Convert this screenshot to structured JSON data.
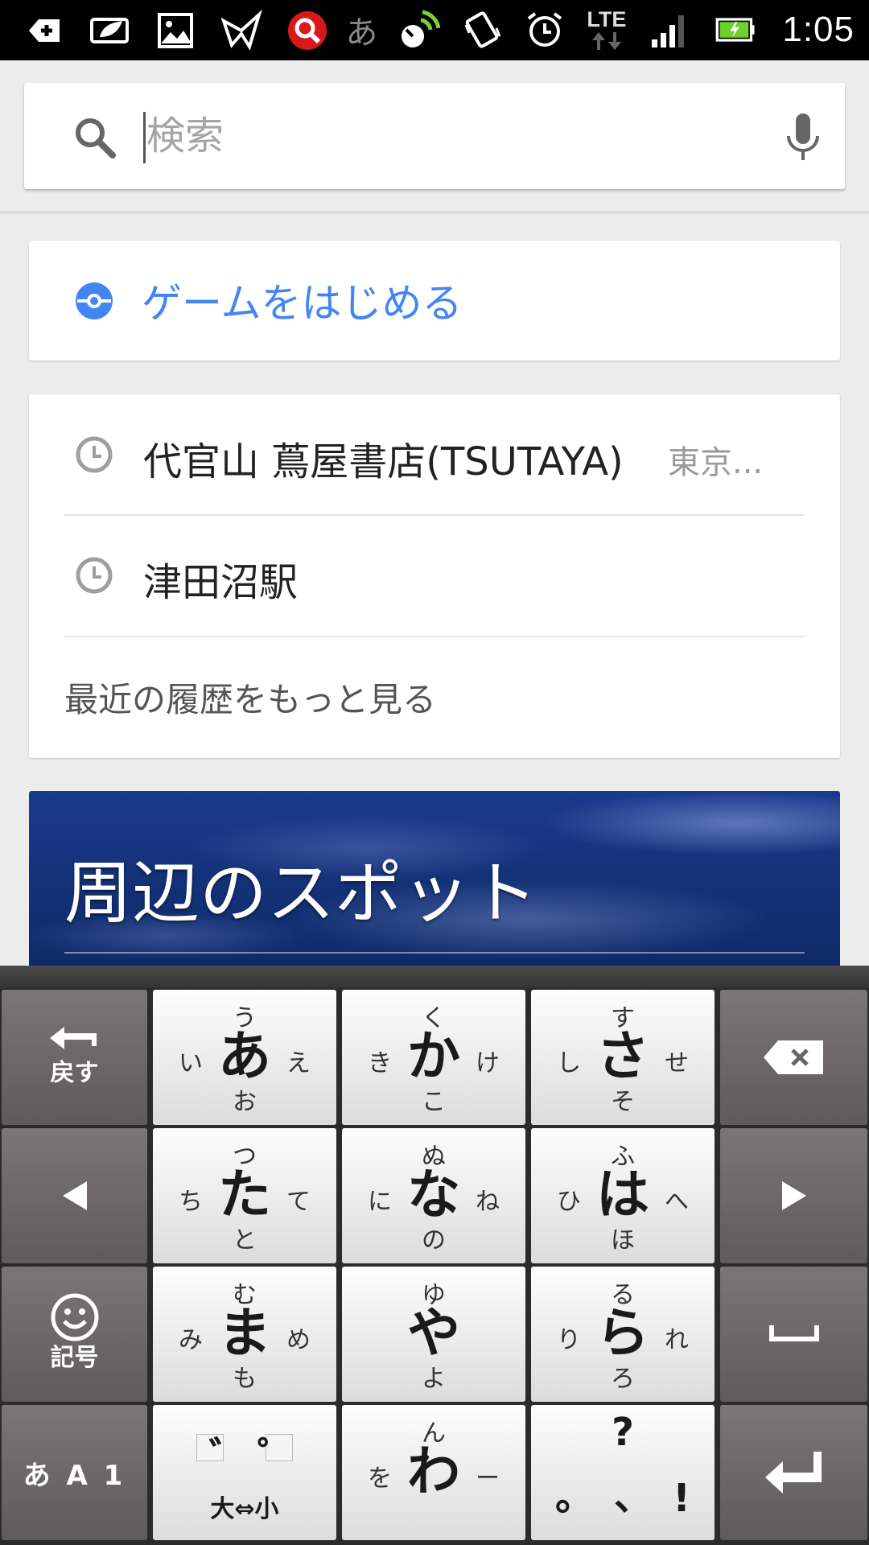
{
  "status_bar": {
    "left_icons": [
      "add-icon",
      "eco-icon",
      "gallery-icon",
      "origami-icon",
      "search-app-icon"
    ],
    "ime_indicator": "あ",
    "network": "LTE",
    "time": "1:05",
    "battery_color": "#6bd12b"
  },
  "search": {
    "placeholder": "検索",
    "value": ""
  },
  "game_card": {
    "label": "ゲームをはじめる",
    "accent": "#4285f4"
  },
  "history": {
    "items": [
      {
        "title": "代官山 蔦屋書店(TSUTAYA)",
        "subtitle": "東京..."
      },
      {
        "title": "津田沼駅",
        "subtitle": ""
      }
    ],
    "more_label": "最近の履歴をもっと見る"
  },
  "spots_card": {
    "title": "周辺のスポット"
  },
  "keyboard": {
    "left_column": {
      "undo_label": "戻す",
      "symbol_label": "記号",
      "mode_label": "あ A 1"
    },
    "keys": [
      {
        "main": "あ",
        "up": "う",
        "left": "い",
        "right": "え",
        "down": "お"
      },
      {
        "main": "か",
        "up": "く",
        "left": "き",
        "right": "け",
        "down": "こ"
      },
      {
        "main": "さ",
        "up": "す",
        "left": "し",
        "right": "せ",
        "down": "そ"
      },
      {
        "main": "た",
        "up": "つ",
        "left": "ち",
        "right": "て",
        "down": "と"
      },
      {
        "main": "な",
        "up": "ぬ",
        "left": "に",
        "right": "ね",
        "down": "の"
      },
      {
        "main": "は",
        "up": "ふ",
        "left": "ひ",
        "right": "へ",
        "down": "ほ"
      },
      {
        "main": "ま",
        "up": "む",
        "left": "み",
        "right": "め",
        "down": "も"
      },
      {
        "main": "や",
        "up": "ゆ",
        "left": "",
        "right": "",
        "down": "よ"
      },
      {
        "main": "ら",
        "up": "る",
        "left": "り",
        "right": "れ",
        "down": "ろ"
      },
      {
        "main": "わ",
        "up": "ん",
        "left": "を",
        "right": "ー",
        "down": ""
      }
    ],
    "dakuten_key": {
      "dakuten": "゛",
      "handakuten": "゜",
      "label": "大⇔小"
    },
    "punct_key": {
      "top": "?",
      "left": "。",
      "middle": "、",
      "right": "!"
    }
  }
}
